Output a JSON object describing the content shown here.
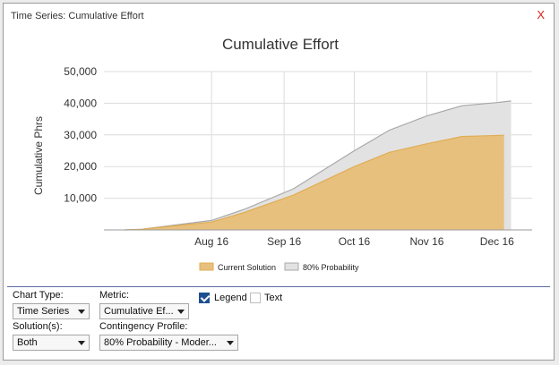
{
  "window": {
    "title": "Time Series: Cumulative Effort",
    "close_label": "X"
  },
  "chart_data": {
    "type": "area",
    "title": "Cumulative Effort",
    "ylabel": "Cumulative Phrs",
    "xlabel": "",
    "ylim": [
      0,
      50000
    ],
    "yticks": [
      10000,
      20000,
      30000,
      40000,
      50000
    ],
    "ytick_labels": [
      "10,000",
      "20,000",
      "30,000",
      "40,000",
      "50,000"
    ],
    "xticks": [
      "2016-08-16",
      "2016-09-16",
      "2016-10-16",
      "2016-11-16",
      "2016-12-16"
    ],
    "xtick_labels": [
      "Aug 16",
      "Sep 16",
      "Oct 16",
      "Nov 16",
      "Dec 16"
    ],
    "xlim": [
      "2016-07-01",
      "2016-12-31"
    ],
    "grid": true,
    "legend_position": "bottom",
    "series": [
      {
        "name": "80% Probability",
        "color": "#e2e2e2",
        "line_color": "#a8a8a8",
        "points": [
          [
            "2016-07-10",
            0
          ],
          [
            "2016-07-17",
            200
          ],
          [
            "2016-08-16",
            3000
          ],
          [
            "2016-08-30",
            6500
          ],
          [
            "2016-09-20",
            13000
          ],
          [
            "2016-10-16",
            25000
          ],
          [
            "2016-10-31",
            31500
          ],
          [
            "2016-11-16",
            36000
          ],
          [
            "2016-12-01",
            39200
          ],
          [
            "2016-12-16",
            40200
          ],
          [
            "2016-12-22",
            40700
          ]
        ]
      },
      {
        "name": "Current Solution",
        "color": "#e8c07d",
        "line_color": "#e0ad55",
        "points": [
          [
            "2016-07-10",
            0
          ],
          [
            "2016-07-17",
            200
          ],
          [
            "2016-08-16",
            2500
          ],
          [
            "2016-08-30",
            5500
          ],
          [
            "2016-09-20",
            11000
          ],
          [
            "2016-10-16",
            20000
          ],
          [
            "2016-10-31",
            24500
          ],
          [
            "2016-11-16",
            27200
          ],
          [
            "2016-12-01",
            29500
          ],
          [
            "2016-12-19",
            29900
          ]
        ]
      }
    ]
  },
  "controls": {
    "chart_type": {
      "label": "Chart Type:",
      "value": "Time Series"
    },
    "metric": {
      "label": "Metric:",
      "value": "Cumulative Ef..."
    },
    "legend_checkbox": {
      "label": "Legend",
      "checked": true
    },
    "text_checkbox": {
      "label": "Text",
      "checked": false
    },
    "solutions": {
      "label": "Solution(s):",
      "value": "Both"
    },
    "contingency_profile": {
      "label": "Contingency Profile:",
      "value": "80% Probability - Moder..."
    }
  }
}
